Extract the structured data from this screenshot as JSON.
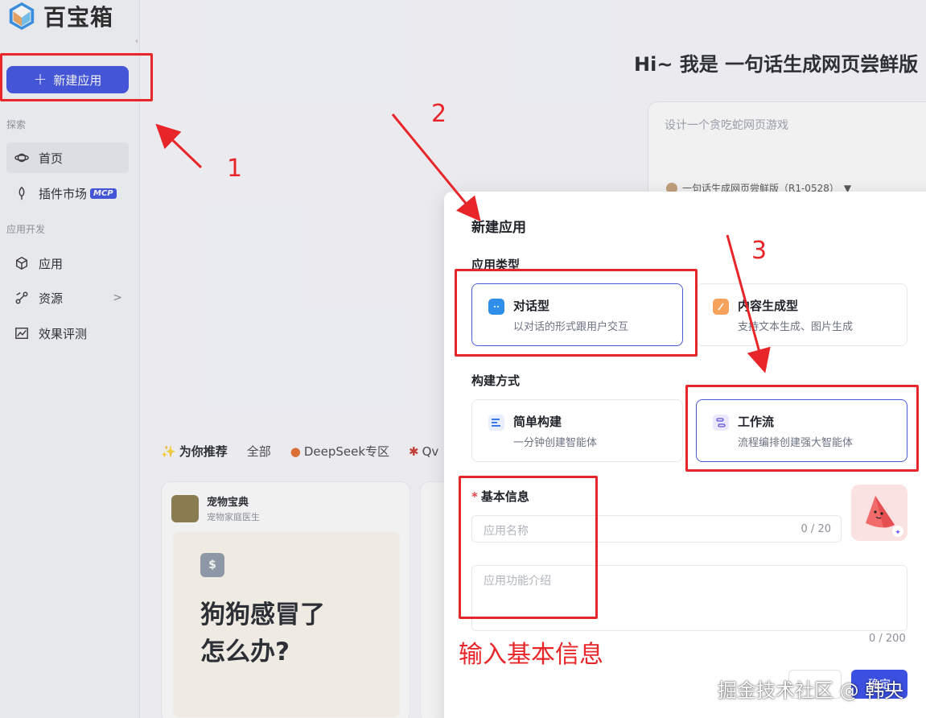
{
  "brand": {
    "name": "百宝箱"
  },
  "sidebar": {
    "new_app_label": "新建应用",
    "section_explore": "探索",
    "section_dev": "应用开发",
    "items": [
      {
        "label": "首页",
        "icon": "planet-icon"
      },
      {
        "label": "插件市场",
        "icon": "plugin-icon",
        "badge": "MCP"
      },
      {
        "label": "应用",
        "icon": "cube-icon"
      },
      {
        "label": "资源",
        "icon": "resource-icon"
      },
      {
        "label": "效果评测",
        "icon": "chart-icon"
      }
    ]
  },
  "main": {
    "hero_title": "Hi~ 我是 一句话生成网页尝鲜版",
    "prompt_placeholder": "设计一个贪吃蛇网页游戏",
    "model_label": "一句话生成网页尝鲜版（R1-0528）",
    "tabs": [
      "为你推荐",
      "全部",
      "DeepSeek专区",
      "Qv"
    ],
    "card": {
      "title": "宠物宝典",
      "subtitle": "宠物家庭医生",
      "headline_1": "狗狗感冒了",
      "headline_2": "怎么办?"
    }
  },
  "modal": {
    "title": "新建应用",
    "type_label": "应用类型",
    "types": [
      {
        "title": "对话型",
        "desc": "以对话的形式跟用户交互"
      },
      {
        "title": "内容生成型",
        "desc": "支持文本生成、图片生成"
      }
    ],
    "build_label": "构建方式",
    "builds": [
      {
        "title": "简单构建",
        "desc": "一分钟创建智能体"
      },
      {
        "title": "工作流",
        "desc": "流程编排创建强大智能体"
      }
    ],
    "basic_label": "基本信息",
    "name_placeholder": "应用名称",
    "name_count": "0 / 20",
    "desc_placeholder": "应用功能介绍",
    "desc_count": "0 / 200",
    "confirm_label": "确定"
  },
  "annotations": {
    "n1": "1",
    "n2": "2",
    "n3": "3",
    "basic_info_note": "输入基本信息",
    "color": "#e8262a"
  },
  "watermark": "掘金技术社区 @ 韩央"
}
